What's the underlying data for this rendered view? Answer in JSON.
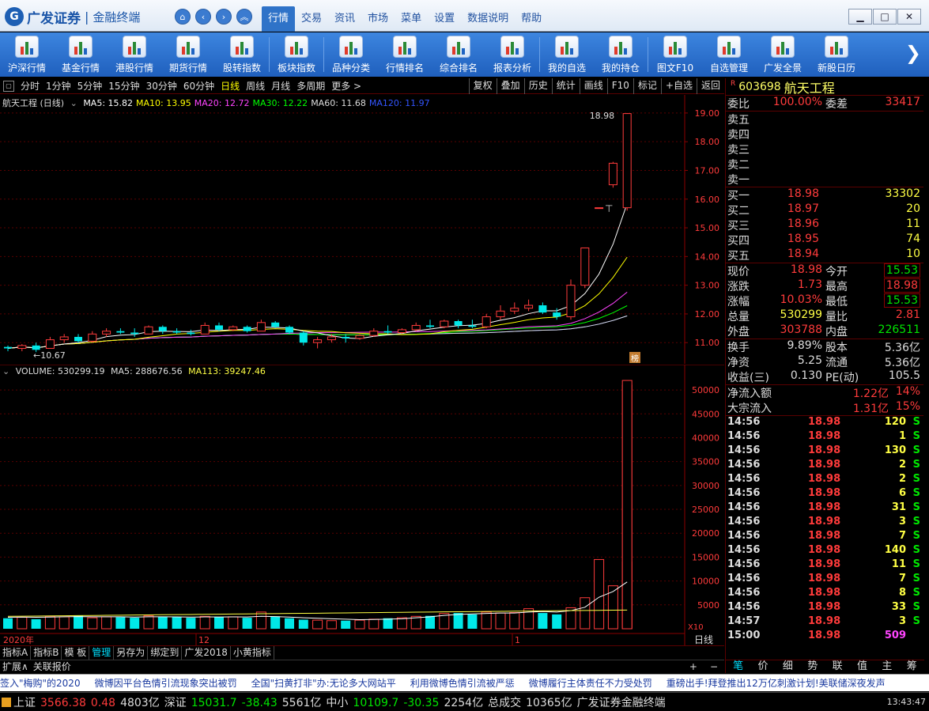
{
  "app": {
    "brand": "广发证券",
    "sub": "金融终端",
    "logo_char": "G"
  },
  "menus": [
    "行情",
    "交易",
    "资讯",
    "市场",
    "菜单",
    "设置",
    "数据说明",
    "帮助"
  ],
  "window_buttons": {
    "min": "▁",
    "max": "□",
    "close": "✕"
  },
  "toolbar": [
    "沪深行情",
    "基金行情",
    "港股行情",
    "期货行情",
    "股转指数",
    "板块指数",
    "品种分类",
    "行情排名",
    "综合排名",
    "报表分析",
    "我的自选",
    "我的持仓",
    "图文F10",
    "自选管理",
    "广发全景",
    "新股日历"
  ],
  "periods": [
    "分时",
    "1分钟",
    "5分钟",
    "15分钟",
    "30分钟",
    "60分钟",
    "日线",
    "周线",
    "月线",
    "多周期",
    "更多 >"
  ],
  "active_period": "日线",
  "chart_ops": [
    "复权",
    "叠加",
    "历史",
    "统计",
    "画线",
    "F10",
    "标记",
    "+自选",
    "返回"
  ],
  "kline": {
    "title": "航天工程 (日线)",
    "ma": [
      {
        "label": "MA5: 15.82",
        "color": "#ffffff"
      },
      {
        "label": "MA10: 13.95",
        "color": "#ffff00"
      },
      {
        "label": "MA20: 12.72",
        "color": "#ff44ff"
      },
      {
        "label": "MA30: 12.22",
        "color": "#00ff00"
      },
      {
        "label": "MA60: 11.68",
        "color": "#dddddd"
      },
      {
        "label": "MA120: 11.97",
        "color": "#3355ff"
      }
    ],
    "high_label": "18.98",
    "low_label": "←10.67",
    "badge": "榜"
  },
  "volume": {
    "title": "VOLUME: 530299.19",
    "ma5": "MA5: 288676.56",
    "ma113": "MA113: 39247.46",
    "unit_tag": "X10"
  },
  "chart_data": [
    {
      "type": "candlestick",
      "title": "航天工程 (日线)",
      "y_ticks": [
        11.0,
        12.0,
        13.0,
        14.0,
        15.0,
        16.0,
        17.0,
        18.0,
        19.0
      ],
      "ylim": [
        10.4,
        19.3
      ],
      "candles": [
        [
          10.85,
          10.9,
          10.7,
          10.8
        ],
        [
          10.8,
          10.95,
          10.7,
          10.9
        ],
        [
          10.9,
          11.0,
          10.67,
          10.75
        ],
        [
          10.8,
          11.2,
          10.8,
          11.1
        ],
        [
          11.1,
          11.3,
          11.0,
          11.2
        ],
        [
          11.2,
          11.3,
          11.0,
          11.05
        ],
        [
          11.05,
          11.4,
          11.0,
          11.3
        ],
        [
          11.3,
          11.5,
          11.2,
          11.4
        ],
        [
          11.4,
          11.5,
          11.3,
          11.35
        ],
        [
          11.35,
          11.5,
          11.2,
          11.3
        ],
        [
          11.3,
          11.6,
          11.3,
          11.55
        ],
        [
          11.55,
          11.6,
          11.3,
          11.4
        ],
        [
          11.4,
          11.5,
          11.3,
          11.35
        ],
        [
          11.35,
          11.45,
          11.25,
          11.3
        ],
        [
          11.3,
          11.7,
          11.3,
          11.6
        ],
        [
          11.6,
          11.7,
          11.4,
          11.45
        ],
        [
          11.45,
          11.6,
          11.4,
          11.55
        ],
        [
          11.55,
          11.6,
          11.35,
          11.4
        ],
        [
          11.4,
          11.8,
          11.4,
          11.7
        ],
        [
          11.7,
          11.75,
          11.5,
          11.55
        ],
        [
          11.55,
          11.6,
          11.3,
          11.35
        ],
        [
          11.35,
          11.4,
          10.9,
          11.0
        ],
        [
          11.0,
          11.2,
          10.8,
          11.1
        ],
        [
          11.1,
          11.3,
          11.0,
          11.2
        ],
        [
          11.2,
          11.3,
          11.0,
          11.15
        ],
        [
          11.15,
          11.3,
          11.1,
          11.25
        ],
        [
          11.25,
          11.5,
          11.2,
          11.4
        ],
        [
          11.4,
          11.6,
          11.3,
          11.35
        ],
        [
          11.35,
          11.5,
          11.3,
          11.45
        ],
        [
          11.45,
          11.7,
          11.4,
          11.6
        ],
        [
          11.6,
          11.8,
          11.5,
          11.55
        ],
        [
          11.55,
          11.8,
          11.5,
          11.75
        ],
        [
          11.75,
          11.8,
          11.5,
          11.6
        ],
        [
          11.6,
          11.8,
          11.5,
          11.55
        ],
        [
          11.55,
          12.0,
          11.5,
          11.9
        ],
        [
          11.9,
          12.3,
          11.8,
          12.1
        ],
        [
          12.1,
          12.4,
          12.0,
          12.2
        ],
        [
          12.2,
          12.5,
          12.1,
          12.3
        ],
        [
          12.3,
          12.4,
          12.0,
          12.05
        ],
        [
          12.05,
          12.2,
          11.8,
          11.9
        ],
        [
          11.9,
          13.2,
          11.8,
          13.0
        ],
        [
          13.0,
          14.3,
          12.9,
          14.3
        ],
        [
          15.7,
          15.7,
          15.7,
          15.7
        ],
        [
          16.5,
          17.3,
          16.4,
          17.25
        ],
        [
          15.7,
          19.0,
          15.6,
          18.98
        ]
      ],
      "volume": {
        "y_ticks": [
          5000,
          10000,
          15000,
          20000,
          25000,
          30000,
          35000,
          40000,
          45000,
          50000
        ],
        "ylim": [
          0,
          53000
        ],
        "values": [
          2200,
          2400,
          2000,
          2600,
          2500,
          2800,
          2300,
          2500,
          2400,
          2300,
          2700,
          2500,
          2400,
          2300,
          2600,
          2400,
          2500,
          2300,
          3500,
          2600,
          2200,
          1900,
          1800,
          1700,
          1700,
          1800,
          2000,
          2200,
          2300,
          2600,
          2700,
          3200,
          3300,
          3000,
          3500,
          3300,
          3400,
          4200,
          3300,
          3000,
          4400,
          6500,
          14500,
          9000,
          14000,
          51000,
          52000
        ],
        "ma_line": [
          2400,
          2450,
          2400,
          2450,
          2500,
          2550,
          2500,
          2500,
          2500,
          2450,
          2500,
          2500,
          2480,
          2450,
          2480,
          2470,
          2480,
          2460,
          2600,
          2550,
          2450,
          2300,
          2200,
          2100,
          2000,
          1900,
          1950,
          2000,
          2100,
          2300,
          2500,
          2800,
          3000,
          3100,
          3200,
          3300,
          3300,
          3500,
          3600,
          3500,
          3800,
          4500,
          6600,
          7800,
          9800,
          17000,
          28000
        ]
      }
    }
  ],
  "axis_bottom": {
    "year_label": "2020年",
    "mark_12": "12",
    "mark_1": "1",
    "period_tag": "日线"
  },
  "chart_ctrl": [
    "指标A",
    "指标B",
    "模 板",
    "管理",
    "另存为",
    "绑定到",
    "广发2018",
    "小黄指标"
  ],
  "chart_ctrl_active": "管理",
  "sub_ctrl": [
    "扩展∧",
    "关联报价"
  ],
  "sub_ctrl_right": [
    "+",
    "−"
  ],
  "quote": {
    "flag": "R",
    "code": "603698",
    "name": "航天工程",
    "weibi_label": "委比",
    "weibi": "100.00%",
    "weicha_label": "委差",
    "weicha": "33417",
    "sell": [
      {
        "label": "卖五",
        "price": "",
        "vol": ""
      },
      {
        "label": "卖四",
        "price": "",
        "vol": ""
      },
      {
        "label": "卖三",
        "price": "",
        "vol": ""
      },
      {
        "label": "卖二",
        "price": "",
        "vol": ""
      },
      {
        "label": "卖一",
        "price": "",
        "vol": ""
      }
    ],
    "buy": [
      {
        "label": "买一",
        "price": "18.98",
        "vol": "33302"
      },
      {
        "label": "买二",
        "price": "18.97",
        "vol": "20"
      },
      {
        "label": "买三",
        "price": "18.96",
        "vol": "11"
      },
      {
        "label": "买四",
        "price": "18.95",
        "vol": "74"
      },
      {
        "label": "买五",
        "price": "18.94",
        "vol": "10"
      }
    ],
    "stats": [
      {
        "a": "现价",
        "b": "18.98",
        "bc": "red",
        "c": "今开",
        "d": "15.53",
        "dc": "green boxed"
      },
      {
        "a": "涨跌",
        "b": "1.73",
        "bc": "red",
        "c": "最高",
        "d": "18.98",
        "dc": "red boxed"
      },
      {
        "a": "涨幅",
        "b": "10.03%",
        "bc": "red",
        "c": "最低",
        "d": "15.53",
        "dc": "green boxed"
      },
      {
        "a": "总量",
        "b": "530299",
        "bc": "yellow",
        "c": "量比",
        "d": "2.81",
        "dc": "red"
      },
      {
        "a": "外盘",
        "b": "303788",
        "bc": "red",
        "c": "内盘",
        "d": "226511",
        "dc": "green"
      }
    ],
    "stats2": [
      {
        "a": "换手",
        "b": "9.89%",
        "bc": "white",
        "c": "股本",
        "d": "5.36亿",
        "dc": "white"
      },
      {
        "a": "净资",
        "b": "5.25",
        "bc": "white",
        "c": "流通",
        "d": "5.36亿",
        "dc": "white"
      },
      {
        "a": "收益(三)",
        "b": "0.130",
        "bc": "white",
        "c": "PE(动)",
        "d": "105.5",
        "dc": "white"
      }
    ],
    "flows": [
      {
        "label": "净流入额",
        "val": "1.22亿",
        "pct": "14%"
      },
      {
        "label": "大宗流入",
        "val": "1.31亿",
        "pct": "15%"
      }
    ],
    "ticks": [
      {
        "t": "14:56",
        "p": "18.98",
        "v": "120",
        "s": "S"
      },
      {
        "t": "14:56",
        "p": "18.98",
        "v": "1",
        "s": "S"
      },
      {
        "t": "14:56",
        "p": "18.98",
        "v": "130",
        "s": "S"
      },
      {
        "t": "14:56",
        "p": "18.98",
        "v": "2",
        "s": "S"
      },
      {
        "t": "14:56",
        "p": "18.98",
        "v": "2",
        "s": "S"
      },
      {
        "t": "14:56",
        "p": "18.98",
        "v": "6",
        "s": "S"
      },
      {
        "t": "14:56",
        "p": "18.98",
        "v": "31",
        "s": "S"
      },
      {
        "t": "14:56",
        "p": "18.98",
        "v": "3",
        "s": "S"
      },
      {
        "t": "14:56",
        "p": "18.98",
        "v": "7",
        "s": "S"
      },
      {
        "t": "14:56",
        "p": "18.98",
        "v": "140",
        "s": "S"
      },
      {
        "t": "14:56",
        "p": "18.98",
        "v": "11",
        "s": "S"
      },
      {
        "t": "14:56",
        "p": "18.98",
        "v": "7",
        "s": "S"
      },
      {
        "t": "14:56",
        "p": "18.98",
        "v": "8",
        "s": "S"
      },
      {
        "t": "14:56",
        "p": "18.98",
        "v": "33",
        "s": "S"
      },
      {
        "t": "14:57",
        "p": "18.98",
        "v": "3",
        "s": "S"
      },
      {
        "t": "15:00",
        "p": "18.98",
        "v": "509",
        "s": ""
      }
    ],
    "tabs": [
      "笔",
      "价",
      "细",
      "势",
      "联",
      "值",
      "主",
      "筹"
    ],
    "active_tab": "笔"
  },
  "news": [
    "签入\"梅购\"的2020",
    "微博因平台色情引流现象突出被罚",
    "全国\"扫黄打非\"办:无论多大网站平",
    "利用微博色情引流被严惩",
    "微博履行主体责任不力受处罚",
    "重磅出手!拜登推出12万亿刺激计划!美联储深夜发声"
  ],
  "status": [
    {
      "text": "上证",
      "cls": "white"
    },
    {
      "text": "3566.38",
      "cls": "red"
    },
    {
      "text": "0.48",
      "cls": "red"
    },
    {
      "text": "4803亿",
      "cls": "white"
    },
    {
      "text": "深证",
      "cls": "white"
    },
    {
      "text": "15031.7",
      "cls": "green"
    },
    {
      "text": "-38.43",
      "cls": "green"
    },
    {
      "text": "5561亿",
      "cls": "white"
    },
    {
      "text": "中小",
      "cls": "white"
    },
    {
      "text": "10109.7",
      "cls": "green"
    },
    {
      "text": "-30.35",
      "cls": "green"
    },
    {
      "text": "2254亿",
      "cls": "white"
    },
    {
      "text": "总成交",
      "cls": "white"
    },
    {
      "text": "10365亿",
      "cls": "white"
    },
    {
      "text": "广发证券金融终端",
      "cls": "white"
    }
  ],
  "status_time": "13:43:47"
}
